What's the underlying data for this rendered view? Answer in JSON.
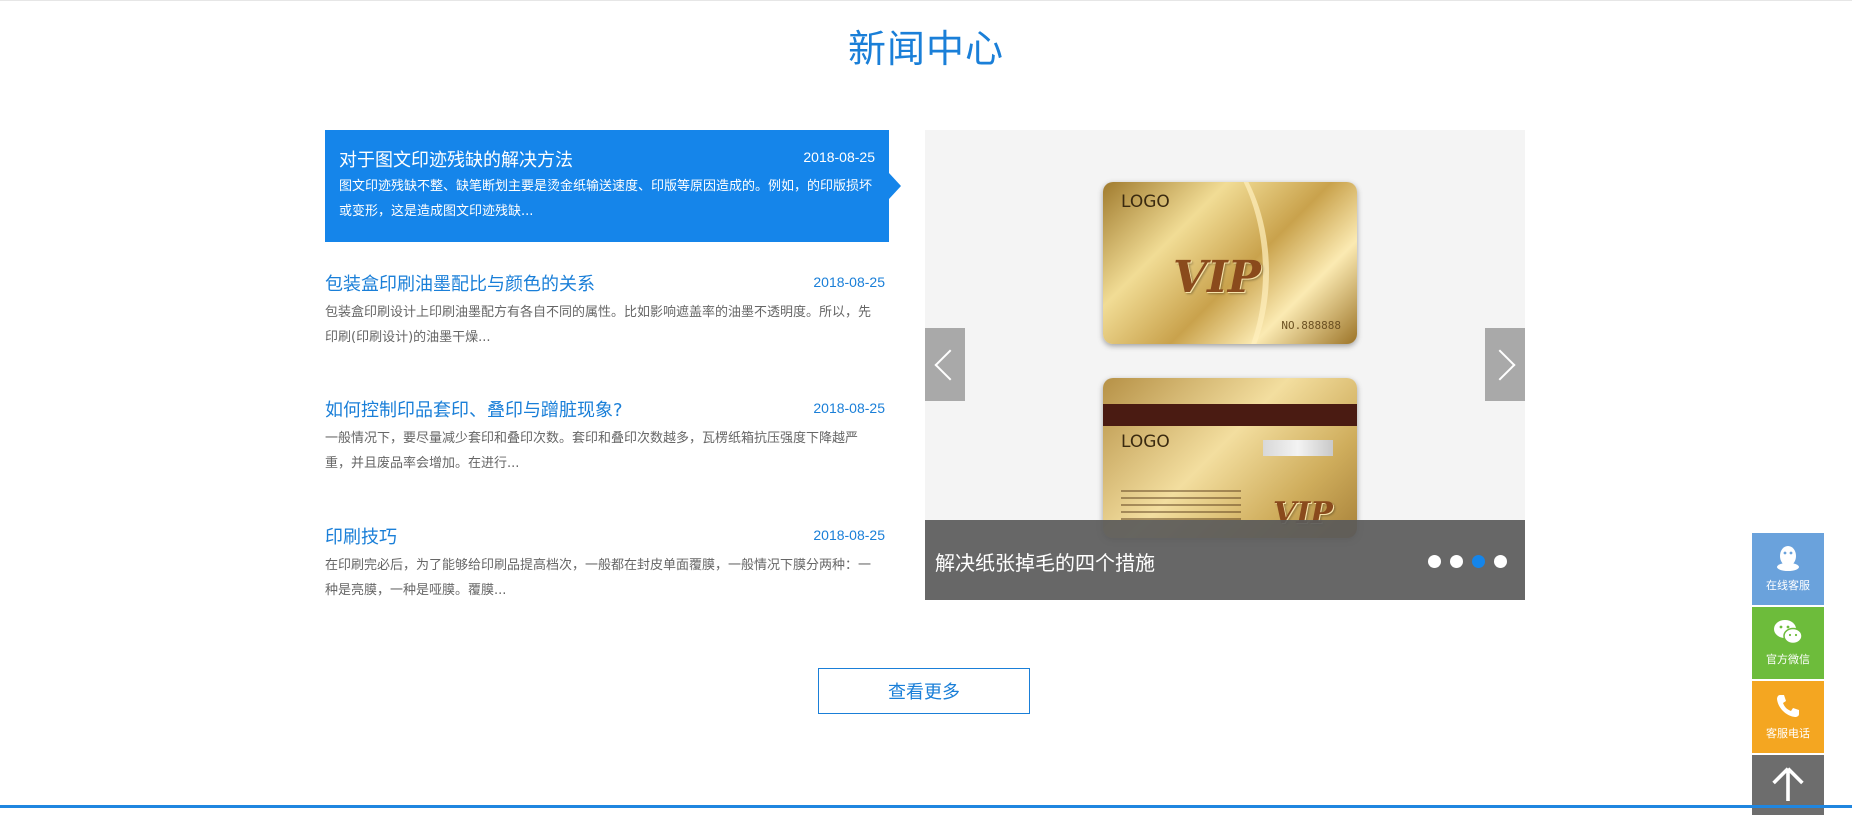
{
  "section": {
    "title": "新闻中心"
  },
  "news": [
    {
      "title": "对于图文印迹残缺的解决方法",
      "date": "2018-08-25",
      "desc": "图文印迹残缺不整、缺笔断划主要是烫金纸输送速度、印版等原因造成的。例如，的印版损坏或变形，这是造成图文印迹残缺..."
    },
    {
      "title": "包装盒印刷油墨配比与颜色的关系",
      "date": "2018-08-25",
      "desc": "包装盒印刷设计上印刷油墨配方有各自不同的属性。比如影响遮盖率的油墨不透明度。所以，先印刷(印刷设计)的油墨干燥..."
    },
    {
      "title": "如何控制印品套印、叠印与蹭脏现象?",
      "date": "2018-08-25",
      "desc": "一般情况下，要尽量减少套印和叠印次数。套印和叠印次数越多，瓦楞纸箱抗压强度下降越严重，并且废品率会增加。在进行..."
    },
    {
      "title": "印刷技巧",
      "date": "2018-08-25",
      "desc": "在印刷完必后，为了能够给印刷品提高档次，一般都在封皮单面覆膜，一般情况下膜分两种：一种是亮膜，一种是哑膜。覆膜..."
    }
  ],
  "slider": {
    "caption": "解决纸张掉毛的四个措施",
    "card_logo_front": "LOGO",
    "card_logo_back": "LOGO",
    "card_vip_front": "VIP",
    "card_vip_back": "VIP",
    "card_serial": "NO.888888",
    "prev_icon": "chevron-left-icon",
    "next_icon": "chevron-right-icon",
    "active_dot_index": 2
  },
  "more_button": "查看更多",
  "side_tools": {
    "qq": "在线客服",
    "wechat": "官方微信",
    "phone": "客服电话"
  },
  "colors": {
    "accent": "#1585ea",
    "title_blue": "#1a7fd8",
    "qq_bg": "#6aa2dc",
    "wechat_bg": "#6dbc3b",
    "phone_bg": "#f4a621",
    "top_bg": "#6d6d6d"
  }
}
